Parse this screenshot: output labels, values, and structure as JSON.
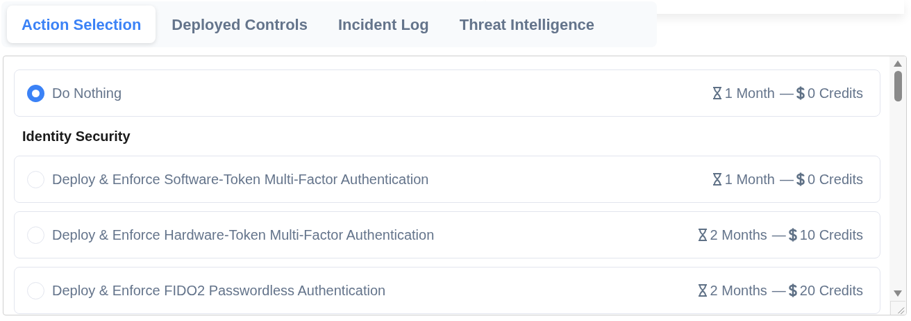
{
  "tabs": [
    {
      "label": "Action Selection",
      "selected": true
    },
    {
      "label": "Deployed Controls",
      "selected": false
    },
    {
      "label": "Incident Log",
      "selected": false
    },
    {
      "label": "Threat Intelligence",
      "selected": false
    }
  ],
  "items": [
    {
      "kind": "option",
      "label": "Do Nothing",
      "selected": true,
      "duration": "1 Month",
      "separator": "—",
      "cost": "0 Credits"
    },
    {
      "kind": "heading",
      "label": "Identity Security"
    },
    {
      "kind": "option",
      "label": "Deploy & Enforce Software-Token Multi-Factor Authentication",
      "selected": false,
      "duration": "1 Month",
      "separator": "—",
      "cost": "0 Credits"
    },
    {
      "kind": "option",
      "label": "Deploy & Enforce Hardware-Token Multi-Factor Authentication",
      "selected": false,
      "duration": "2 Months",
      "separator": "—",
      "cost": "10 Credits"
    },
    {
      "kind": "option",
      "label": "Deploy & Enforce FIDO2 Passwordless Authentication",
      "selected": false,
      "duration": "2 Months",
      "separator": "—",
      "cost": "20 Credits"
    }
  ]
}
